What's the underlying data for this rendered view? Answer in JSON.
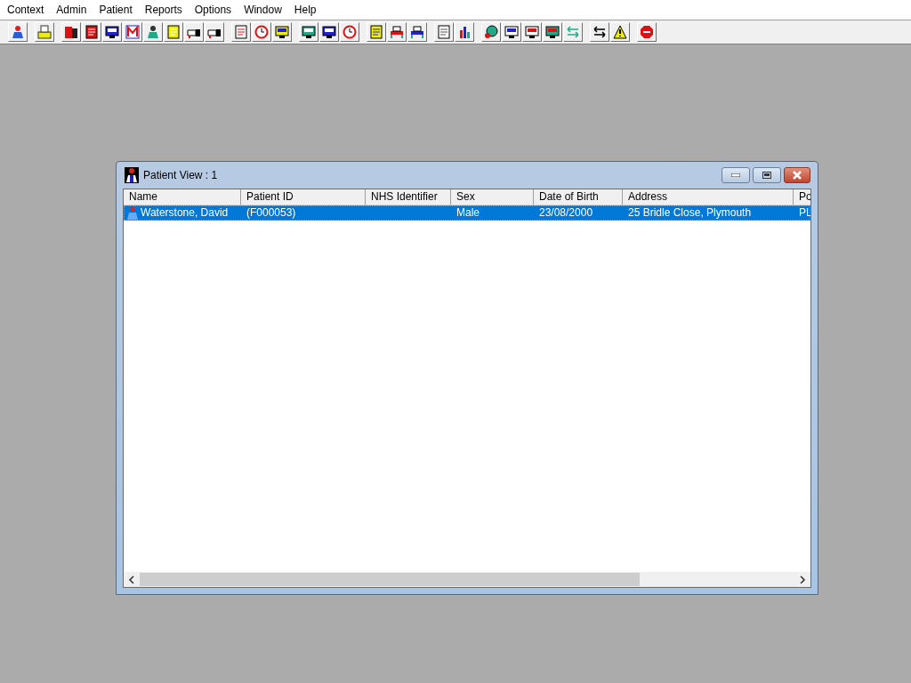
{
  "menu": [
    "Context",
    "Admin",
    "Patient",
    "Reports",
    "Options",
    "Window",
    "Help"
  ],
  "window": {
    "title": "Patient View : 1"
  },
  "table": {
    "columns": [
      "Name",
      "Patient ID",
      "NHS Identifier",
      "Sex",
      "Date of Birth",
      "Address",
      "Po"
    ],
    "rows": [
      {
        "selected": true,
        "cells": [
          "Waterstone, David",
          "(F000053)",
          "",
          "Male",
          "23/08/2000",
          "25 Bridle Close, Plymouth",
          "PL"
        ]
      }
    ]
  }
}
